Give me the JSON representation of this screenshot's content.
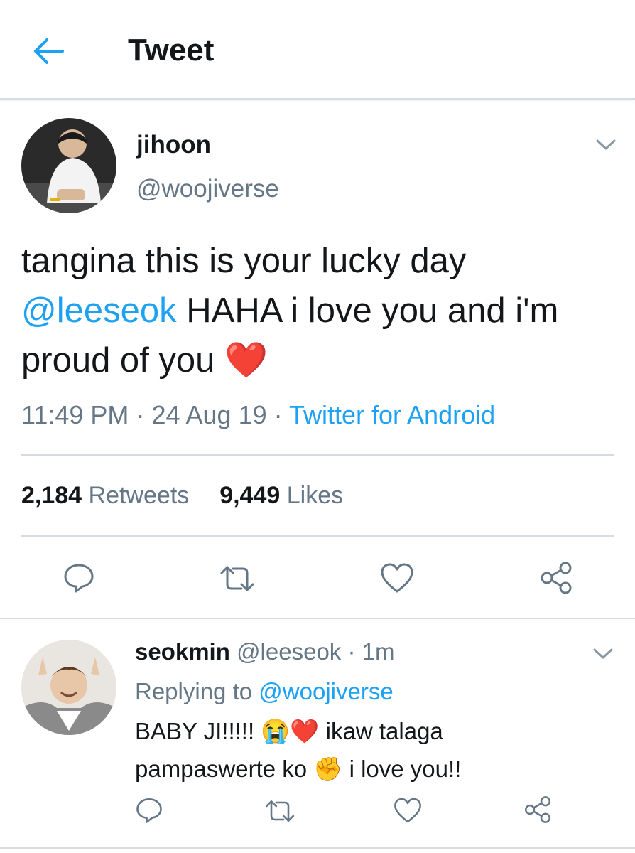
{
  "header": {
    "title": "Tweet"
  },
  "tweet": {
    "author_name": "jihoon",
    "author_handle": "@woojiverse",
    "text_part1": "tangina this is your lucky day",
    "mention": "@leeseok",
    "text_part2": " HAHA i love you and i'm proud of you",
    "emoji": "❤️",
    "time": "11:49 PM",
    "date": "24 Aug 19",
    "source": "Twitter for Android",
    "retweets_count": "2,184",
    "retweets_label": "Retweets",
    "likes_count": "9,449",
    "likes_label": "Likes"
  },
  "reply": {
    "author_name": "seokmin",
    "author_handle": "@leeseok",
    "age": "1m",
    "replying_label": "Replying to",
    "replying_handle": "@woojiverse",
    "line1_text": "BABY JI!!!!!",
    "line1_emoji": "😭❤️",
    "line1_rest": "ikaw talaga",
    "line2_text": "pampaswerte ko",
    "line2_emoji": "✊",
    "line2_rest": "i love you!!"
  },
  "colors": {
    "accent": "#1da1f2",
    "text": "#14171a",
    "secondary": "#657786",
    "divider": "#d6dbe0"
  },
  "icons": [
    "back-arrow-icon",
    "chevron-down-icon",
    "reply-icon",
    "retweet-icon",
    "like-icon",
    "share-icon"
  ]
}
